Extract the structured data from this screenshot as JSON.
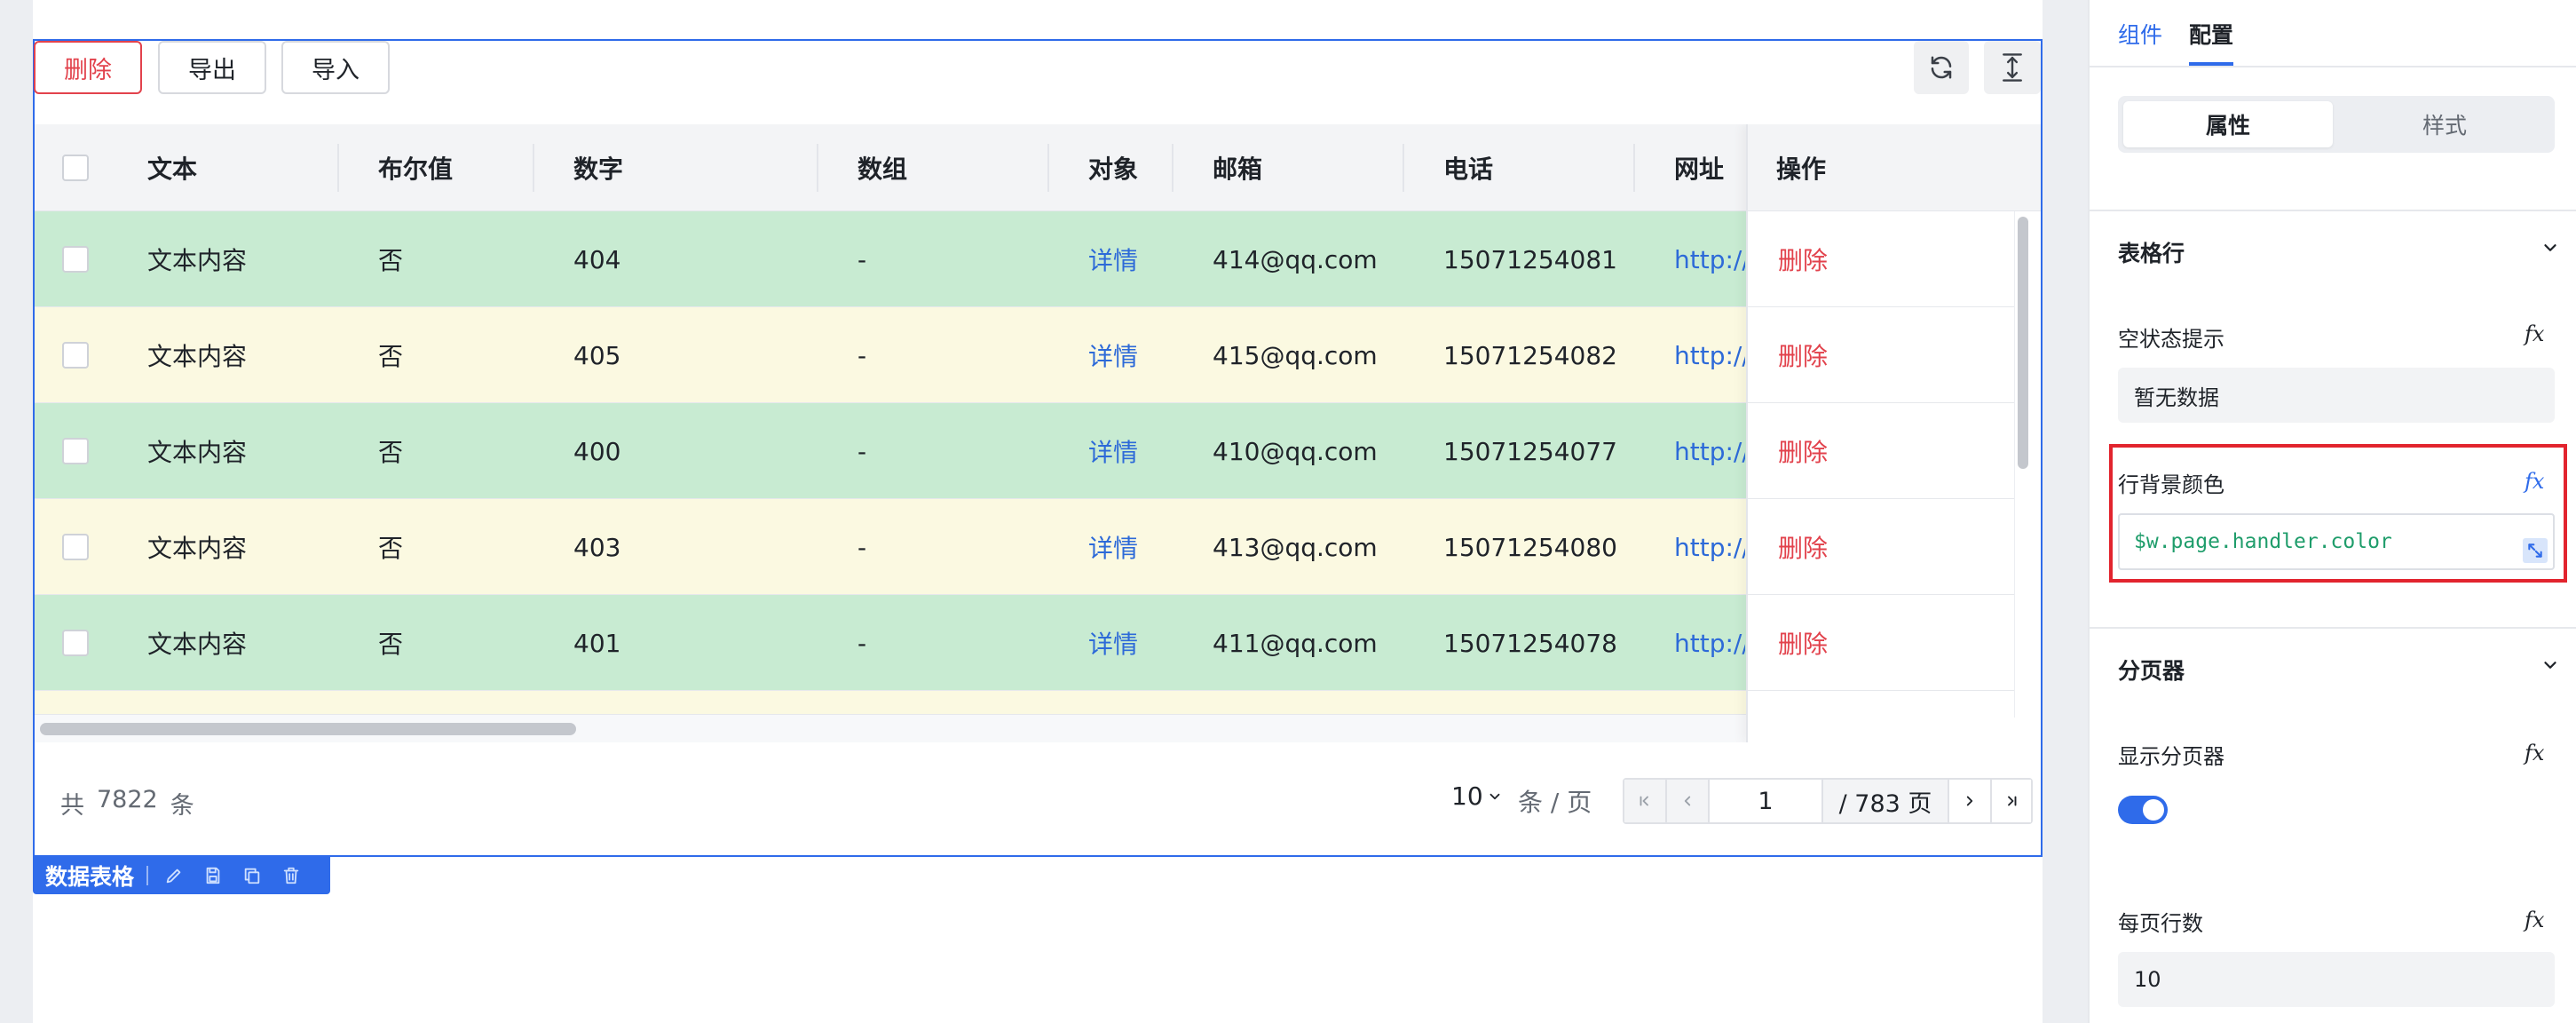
{
  "toolbar": {
    "delete_label": "删除",
    "export_label": "导出",
    "import_label": "导入"
  },
  "table": {
    "columns": [
      "文本",
      "布尔值",
      "数字",
      "数组",
      "对象",
      "邮箱",
      "电话",
      "网址",
      "操作"
    ],
    "rows": [
      {
        "text": "文本内容",
        "bool": "否",
        "num": "404",
        "arr": "-",
        "obj": "详情",
        "email": "414@qq.com",
        "phone": "15071254081",
        "url": "http://c",
        "op": "删除",
        "bg": "#c8ebd2"
      },
      {
        "text": "文本内容",
        "bool": "否",
        "num": "405",
        "arr": "-",
        "obj": "详情",
        "email": "415@qq.com",
        "phone": "15071254082",
        "url": "http://c",
        "op": "删除",
        "bg": "#fbf9e1"
      },
      {
        "text": "文本内容",
        "bool": "否",
        "num": "400",
        "arr": "-",
        "obj": "详情",
        "email": "410@qq.com",
        "phone": "15071254077",
        "url": "http://c",
        "op": "删除",
        "bg": "#c8ebd2"
      },
      {
        "text": "文本内容",
        "bool": "否",
        "num": "403",
        "arr": "-",
        "obj": "详情",
        "email": "413@qq.com",
        "phone": "15071254080",
        "url": "http://c",
        "op": "删除",
        "bg": "#fbf9e1"
      },
      {
        "text": "文本内容",
        "bool": "否",
        "num": "401",
        "arr": "-",
        "obj": "详情",
        "email": "411@qq.com",
        "phone": "15071254078",
        "url": "http://c",
        "op": "删除",
        "bg": "#c8ebd2"
      },
      {
        "text": "",
        "bool": "",
        "num": "",
        "arr": "",
        "obj": "",
        "email": "",
        "phone": "",
        "url": "",
        "op": "",
        "bg": "#fbf9e1"
      }
    ]
  },
  "footer": {
    "total_prefix": "共",
    "total_count": "7822",
    "total_suffix": "条",
    "page_size": "10",
    "page_size_unit": "条 / 页",
    "current_page": "1",
    "total_pages": "/ 783 页"
  },
  "component_tag": {
    "label": "数据表格"
  },
  "panel": {
    "tabs": {
      "components": "组件",
      "config": "配置"
    },
    "segment": {
      "attributes": "属性",
      "style": "样式"
    },
    "sections": {
      "table_row": "表格行",
      "pagination": "分页器"
    },
    "fields": {
      "empty_hint_label": "空状态提示",
      "empty_hint_value": "暂无数据",
      "row_bg_label": "行背景颜色",
      "row_bg_value": "$w.page.handler.color",
      "show_pager_label": "显示分页器",
      "rows_per_page_label": "每页行数",
      "rows_per_page_value": "10"
    },
    "fx_symbol": "fx"
  },
  "colors": {
    "accent": "#2f6bea",
    "danger": "#e2424c",
    "row_green": "#c8ebd2",
    "row_yellow": "#fbf9e1"
  }
}
